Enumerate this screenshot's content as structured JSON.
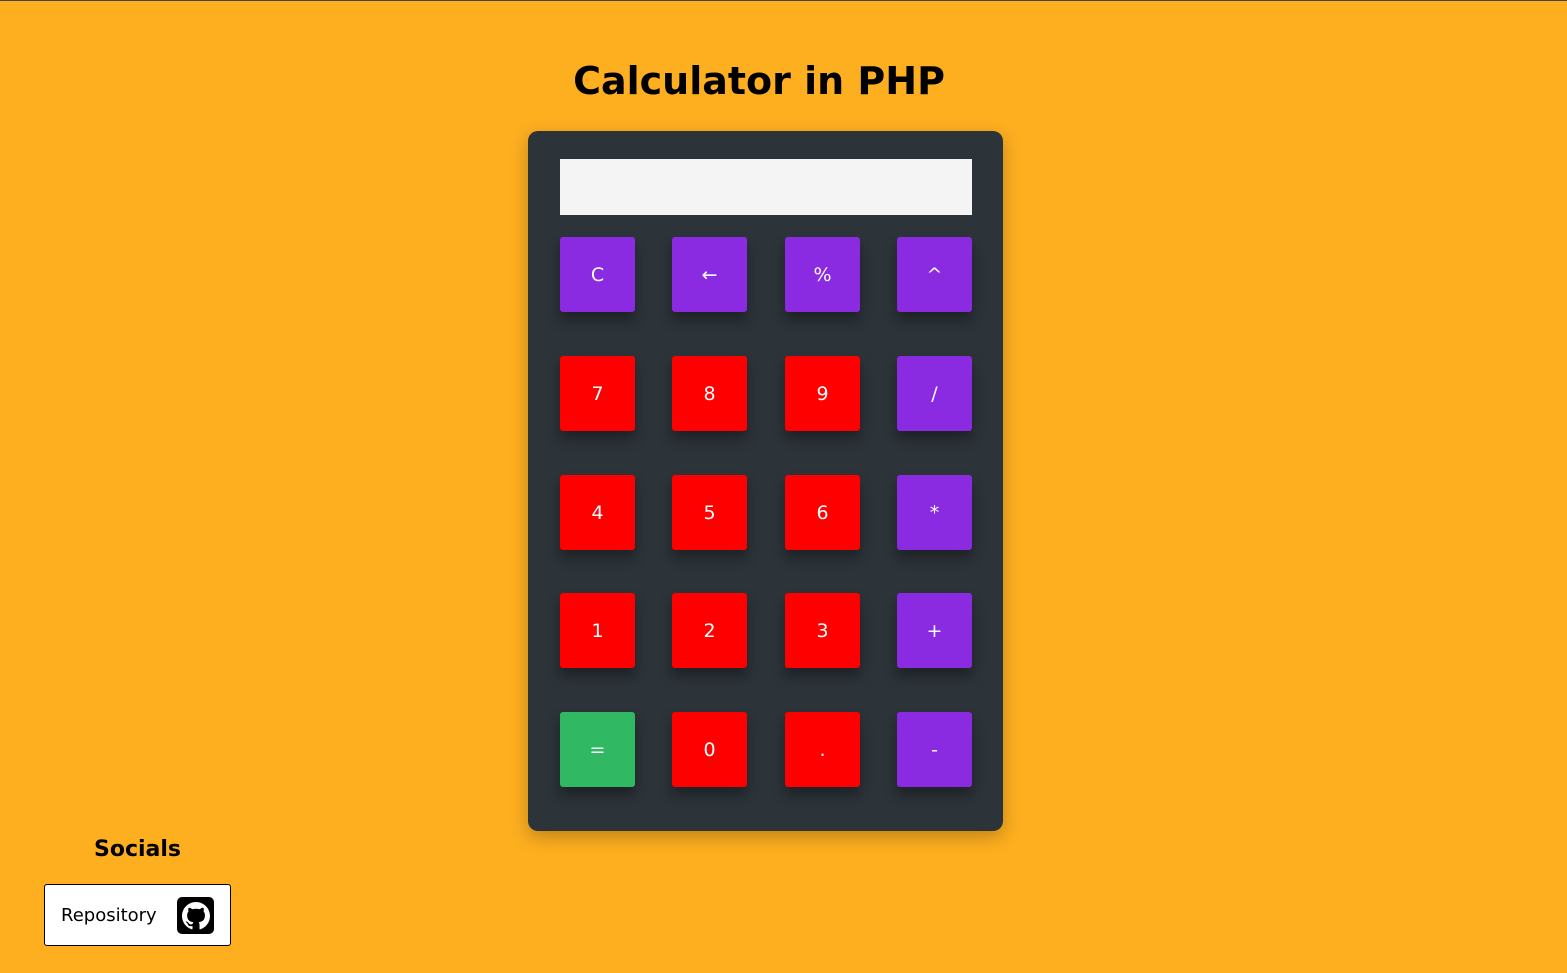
{
  "page": {
    "title": "Calculator in PHP"
  },
  "colors": {
    "background": "#feaf20",
    "calculator_body": "#2c3339",
    "operator": "#8a2be2",
    "digit": "#ff0000",
    "equals": "#30b962",
    "display": "#f4f4f4"
  },
  "calculator": {
    "display_value": "",
    "keys": [
      {
        "label": "C",
        "kind": "operator"
      },
      {
        "label": "←",
        "kind": "operator"
      },
      {
        "label": "%",
        "kind": "operator"
      },
      {
        "label": "^",
        "kind": "operator"
      },
      {
        "label": "7",
        "kind": "digit"
      },
      {
        "label": "8",
        "kind": "digit"
      },
      {
        "label": "9",
        "kind": "digit"
      },
      {
        "label": "/",
        "kind": "operator"
      },
      {
        "label": "4",
        "kind": "digit"
      },
      {
        "label": "5",
        "kind": "digit"
      },
      {
        "label": "6",
        "kind": "digit"
      },
      {
        "label": "*",
        "kind": "operator"
      },
      {
        "label": "1",
        "kind": "digit"
      },
      {
        "label": "2",
        "kind": "digit"
      },
      {
        "label": "3",
        "kind": "digit"
      },
      {
        "label": "+",
        "kind": "operator"
      },
      {
        "label": "=",
        "kind": "equals"
      },
      {
        "label": "0",
        "kind": "digit"
      },
      {
        "label": ".",
        "kind": "digit"
      },
      {
        "label": "-",
        "kind": "operator"
      }
    ]
  },
  "socials": {
    "heading": "Socials",
    "repository_label": "Repository",
    "repository_icon": "github-icon"
  }
}
